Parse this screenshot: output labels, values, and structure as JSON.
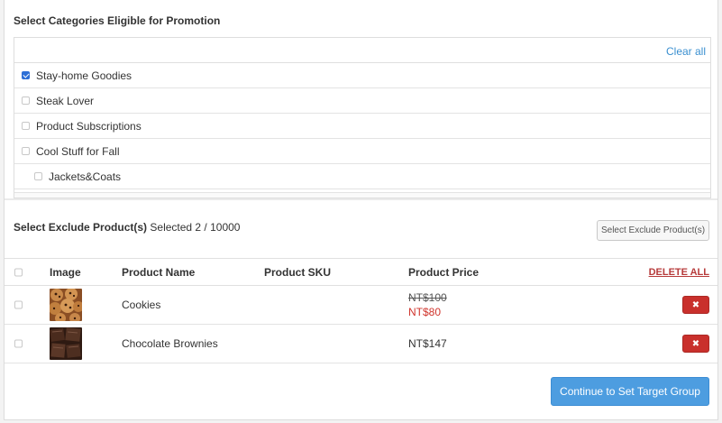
{
  "categories": {
    "title": "Select Categories Eligible for Promotion",
    "clear_all": "Clear all",
    "items": [
      {
        "label": "Stay-home Goodies",
        "checked": true,
        "sub": false
      },
      {
        "label": "Steak Lover",
        "checked": false,
        "sub": false
      },
      {
        "label": "Product Subscriptions",
        "checked": false,
        "sub": false
      },
      {
        "label": "Cool Stuff for Fall",
        "checked": false,
        "sub": false
      },
      {
        "label": "Jackets&Coats",
        "checked": false,
        "sub": true
      }
    ]
  },
  "exclude": {
    "title": "Select Exclude Product(s)",
    "selected_text": "Selected 2 / 10000",
    "select_button": "Select Exclude Product(s)"
  },
  "table": {
    "headers": {
      "image": "Image",
      "name": "Product Name",
      "sku": "Product SKU",
      "price": "Product Price",
      "delete_all": "DELETE ALL"
    },
    "rows": [
      {
        "name": "Cookies",
        "sku": "",
        "price_old": "NT$100",
        "price_new": "NT$80",
        "thumb": "cookies-thumbnail"
      },
      {
        "name": "Chocolate Brownies",
        "sku": "",
        "price": "NT$147",
        "thumb": "brownies-thumbnail"
      }
    ],
    "delete_icon": "close-icon"
  },
  "continue_button": "Continue to Set Target Group",
  "colors": {
    "link": "#3a8fd0",
    "delete": "#c9302c",
    "sale_price": "#d0342c",
    "primary": "#4d9de0",
    "checkbox_checked": "#2d6fd6"
  }
}
